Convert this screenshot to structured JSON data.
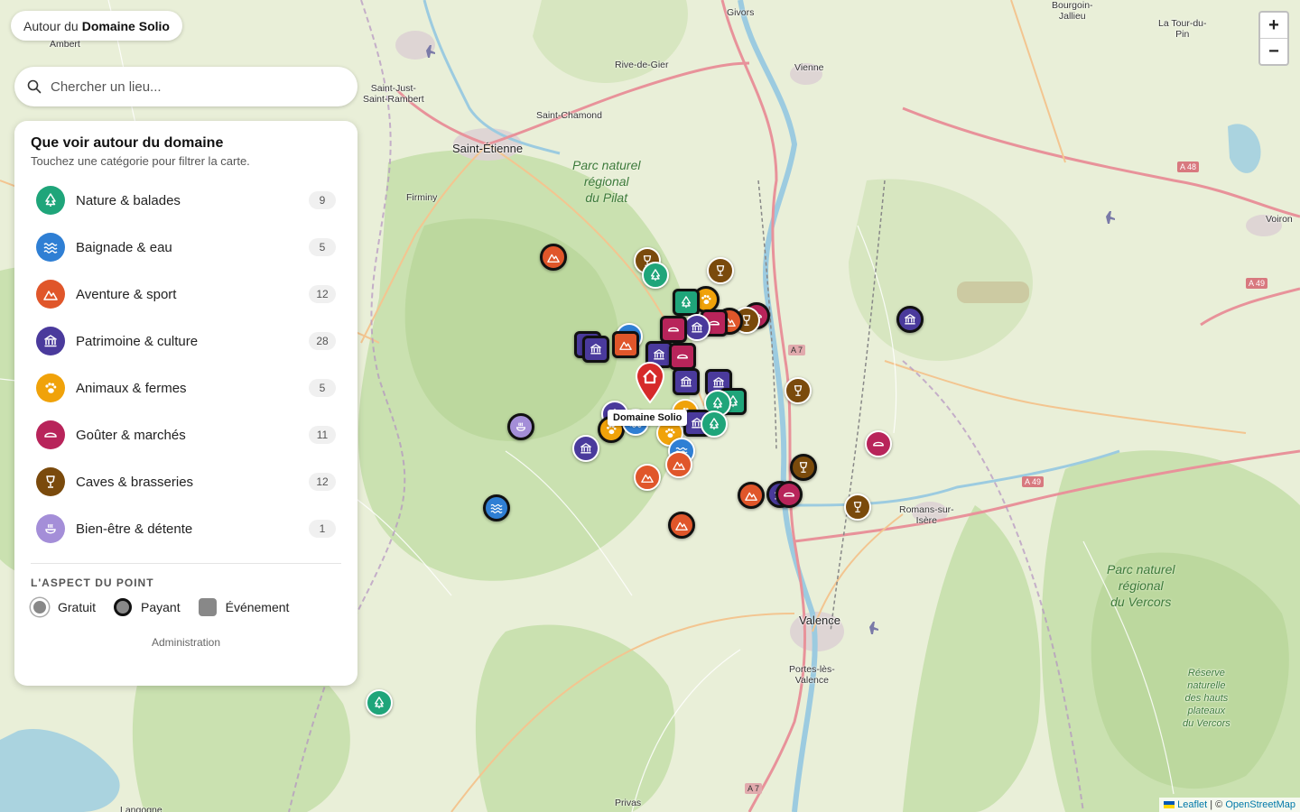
{
  "header": {
    "prefix": "Autour du",
    "name": "Domaine Solio"
  },
  "search": {
    "placeholder": "Chercher un lieu..."
  },
  "panel": {
    "title": "Que voir autour du domaine",
    "subtitle": "Touchez une catégorie pour filtrer la carte.",
    "categories": [
      {
        "label": "Nature & balades",
        "count": "9",
        "color": "#1fa57a",
        "icon": "tree-icon"
      },
      {
        "label": "Baignade & eau",
        "count": "5",
        "color": "#2f7fd4",
        "icon": "waves-icon"
      },
      {
        "label": "Aventure & sport",
        "count": "12",
        "color": "#e0562a",
        "icon": "mountain-icon"
      },
      {
        "label": "Patrimoine & culture",
        "count": "28",
        "color": "#4a3a9c",
        "icon": "museum-icon"
      },
      {
        "label": "Animaux & fermes",
        "count": "5",
        "color": "#f0a20a",
        "icon": "paw-icon"
      },
      {
        "label": "Goûter & marchés",
        "count": "11",
        "color": "#b8245a",
        "icon": "bowl-icon"
      },
      {
        "label": "Caves & brasseries",
        "count": "12",
        "color": "#7a4a0c",
        "icon": "glass-icon"
      },
      {
        "label": "Bien-être & détente",
        "count": "1",
        "color": "#a48ed8",
        "icon": "spa-icon"
      }
    ],
    "legend_title": "L'ASPECT DU POINT",
    "legend": {
      "free": "Gratuit",
      "paid": "Payant",
      "event": "Événement"
    },
    "admin_link": "Administration"
  },
  "map": {
    "home_label": "Domaine Solio",
    "zoom_in": "+",
    "zoom_out": "−",
    "attribution": {
      "leaflet": "Leaflet",
      "sep": " | © ",
      "osm": "OpenStreetMap"
    },
    "places": {
      "givors": "Givors",
      "vienne": "Vienne",
      "rive": "Rive-de-Gier",
      "stetienne": "Saint-Étienne",
      "stjust": "Saint-Just-\nSaint-Rambert",
      "stchamond": "Saint-Chamond",
      "firminy": "Firminy",
      "ambert": "Ambert",
      "bourgoin": "Bourgoin-\nJallieu",
      "latour": "La Tour-du-\nPin",
      "voiron": "Voiron",
      "romans": "Romans-sur-\nIsère",
      "valence": "Valence",
      "portes": "Portes-lès-\nValence",
      "privas": "Privas",
      "langogne": "Langogne",
      "pilat": "Parc naturel\nrégional\ndu Pilat",
      "vercors": "Parc naturel\nrégional\ndu Vercors",
      "reserve": "Réserve\nnaturelle\ndes hauts\nplateaux\ndu Vercors"
    },
    "roads": {
      "a7": "A 7",
      "a48": "A 48",
      "a49": "A 49"
    },
    "markers": [
      {
        "c": "#e0562a",
        "s": "paid",
        "i": "mountain",
        "x": 0.426,
        "y": 0.317
      },
      {
        "c": "#7a4a0c",
        "s": "free",
        "i": "glass",
        "x": 0.498,
        "y": 0.321
      },
      {
        "c": "#1fa57a",
        "s": "free",
        "i": "tree",
        "x": 0.504,
        "y": 0.339
      },
      {
        "c": "#7a4a0c",
        "s": "free",
        "i": "glass",
        "x": 0.554,
        "y": 0.333
      },
      {
        "c": "#4a3a9c",
        "s": "paid",
        "i": "museum",
        "x": 0.7,
        "y": 0.393
      },
      {
        "c": "#f0a20a",
        "s": "paid",
        "i": "paw",
        "x": 0.543,
        "y": 0.369
      },
      {
        "c": "#1fa57a",
        "s": "event",
        "i": "tree",
        "x": 0.528,
        "y": 0.372
      },
      {
        "c": "#b8245a",
        "s": "paid",
        "i": "bowl",
        "x": 0.582,
        "y": 0.389
      },
      {
        "c": "#7a4a0c",
        "s": "free",
        "i": "glass",
        "x": 0.574,
        "y": 0.394
      },
      {
        "c": "#e0562a",
        "s": "paid",
        "i": "mountain",
        "x": 0.561,
        "y": 0.396
      },
      {
        "c": "#b8245a",
        "s": "event",
        "i": "bowl",
        "x": 0.549,
        "y": 0.398
      },
      {
        "c": "#4a3a9c",
        "s": "free",
        "i": "museum",
        "x": 0.536,
        "y": 0.403
      },
      {
        "c": "#b8245a",
        "s": "event",
        "i": "bowl",
        "x": 0.518,
        "y": 0.406
      },
      {
        "c": "#4a3a9c",
        "s": "event",
        "i": "museum",
        "x": 0.452,
        "y": 0.424
      },
      {
        "c": "#4a3a9c",
        "s": "event",
        "i": "museum",
        "x": 0.458,
        "y": 0.43
      },
      {
        "c": "#2f7fd4",
        "s": "free",
        "i": "waves",
        "x": 0.484,
        "y": 0.414
      },
      {
        "c": "#e0562a",
        "s": "event",
        "i": "mountain",
        "x": 0.481,
        "y": 0.424
      },
      {
        "c": "#4a3a9c",
        "s": "event",
        "i": "museum",
        "x": 0.507,
        "y": 0.437
      },
      {
        "c": "#b8245a",
        "s": "event",
        "i": "bowl",
        "x": 0.525,
        "y": 0.439
      },
      {
        "c": "#4a3a9c",
        "s": "event",
        "i": "museum",
        "x": 0.528,
        "y": 0.47
      },
      {
        "c": "#4a3a9c",
        "s": "event",
        "i": "museum",
        "x": 0.553,
        "y": 0.471
      },
      {
        "c": "#1fa57a",
        "s": "event",
        "i": "tree",
        "x": 0.564,
        "y": 0.494
      },
      {
        "c": "#1fa57a",
        "s": "free",
        "i": "tree",
        "x": 0.552,
        "y": 0.497
      },
      {
        "c": "#7a4a0c",
        "s": "free",
        "i": "glass",
        "x": 0.614,
        "y": 0.481
      },
      {
        "c": "#4a3a9c",
        "s": "free",
        "i": "museum",
        "x": 0.473,
        "y": 0.51
      },
      {
        "c": "#f0a20a",
        "s": "paid",
        "i": "paw",
        "x": 0.47,
        "y": 0.529
      },
      {
        "c": "#2f7fd4",
        "s": "free",
        "i": "waves",
        "x": 0.489,
        "y": 0.52
      },
      {
        "c": "#f0a20a",
        "s": "free",
        "i": "paw",
        "x": 0.527,
        "y": 0.508
      },
      {
        "c": "#f0a20a",
        "s": "free",
        "i": "paw",
        "x": 0.515,
        "y": 0.533
      },
      {
        "c": "#4a3a9c",
        "s": "event",
        "i": "museum",
        "x": 0.536,
        "y": 0.521
      },
      {
        "c": "#1fa57a",
        "s": "free",
        "i": "tree",
        "x": 0.549,
        "y": 0.522
      },
      {
        "c": "#a48ed8",
        "s": "paid",
        "i": "spa",
        "x": 0.401,
        "y": 0.526
      },
      {
        "c": "#4a3a9c",
        "s": "free",
        "i": "museum",
        "x": 0.451,
        "y": 0.552
      },
      {
        "c": "#2f7fd4",
        "s": "free",
        "i": "waves",
        "x": 0.524,
        "y": 0.556
      },
      {
        "c": "#e0562a",
        "s": "free",
        "i": "mountain",
        "x": 0.522,
        "y": 0.572
      },
      {
        "c": "#e0562a",
        "s": "free",
        "i": "mountain",
        "x": 0.498,
        "y": 0.588
      },
      {
        "c": "#e0562a",
        "s": "paid",
        "i": "mountain",
        "x": 0.524,
        "y": 0.647
      },
      {
        "c": "#7a4a0c",
        "s": "paid",
        "i": "glass",
        "x": 0.618,
        "y": 0.576
      },
      {
        "c": "#b8245a",
        "s": "free",
        "i": "bowl",
        "x": 0.676,
        "y": 0.547
      },
      {
        "c": "#e0562a",
        "s": "paid",
        "i": "mountain",
        "x": 0.578,
        "y": 0.61
      },
      {
        "c": "#4a3a9c",
        "s": "paid",
        "i": "museum",
        "x": 0.6,
        "y": 0.609
      },
      {
        "c": "#b8245a",
        "s": "paid",
        "i": "bowl",
        "x": 0.607,
        "y": 0.609
      },
      {
        "c": "#7a4a0c",
        "s": "free",
        "i": "glass",
        "x": 0.66,
        "y": 0.624
      },
      {
        "c": "#2f7fd4",
        "s": "paid",
        "i": "waves",
        "x": 0.382,
        "y": 0.626
      },
      {
        "c": "#1fa57a",
        "s": "free",
        "i": "tree",
        "x": 0.292,
        "y": 0.866
      }
    ]
  }
}
